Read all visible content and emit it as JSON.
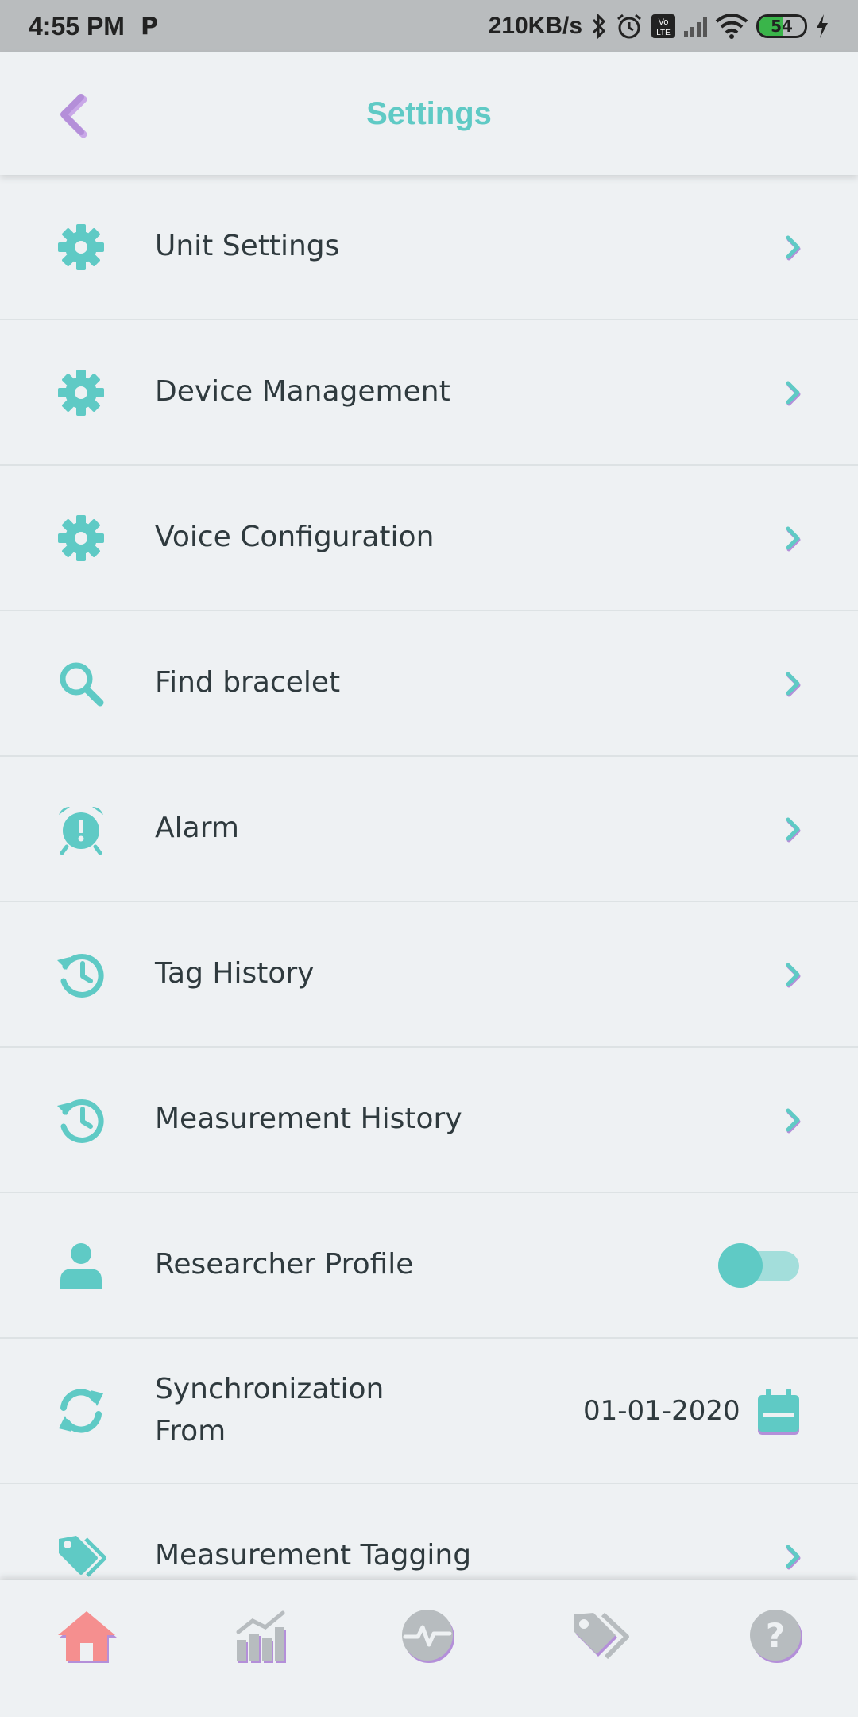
{
  "status_bar": {
    "time": "4:55 PM",
    "p_glyph": "P",
    "net_speed": "210KB/s",
    "battery": "54",
    "icons": [
      "bluetooth-icon",
      "alarm-icon",
      "volte-icon",
      "signal-icon",
      "wifi-icon",
      "battery-icon",
      "charging-icon"
    ]
  },
  "header": {
    "title": "Settings",
    "back_icon": "chevron-left-icon"
  },
  "settings": {
    "items": [
      {
        "label": "Unit Settings",
        "icon": "gear-icon",
        "action": "chevron"
      },
      {
        "label": "Device Management",
        "icon": "gear-icon",
        "action": "chevron"
      },
      {
        "label": "Voice Configuration",
        "icon": "gear-icon",
        "action": "chevron"
      },
      {
        "label": "Find bracelet",
        "icon": "search-icon",
        "action": "chevron"
      },
      {
        "label": "Alarm",
        "icon": "alarm-clock-icon",
        "action": "chevron"
      },
      {
        "label": "Tag History",
        "icon": "history-icon",
        "action": "chevron"
      },
      {
        "label": "Measurement History",
        "icon": "history-icon",
        "action": "chevron"
      },
      {
        "label": "Researcher Profile",
        "icon": "person-icon",
        "action": "toggle",
        "toggle_on": true
      },
      {
        "label": "Synchronization",
        "label_line2": "From",
        "icon": "sync-icon",
        "action": "date",
        "date": "01-01-2020"
      },
      {
        "label": "Measurement Tagging",
        "icon": "tag-icon",
        "action": "chevron"
      }
    ]
  },
  "bottom_nav": {
    "items": [
      {
        "icon": "home-icon",
        "active": true
      },
      {
        "icon": "bar-chart-icon",
        "active": false
      },
      {
        "icon": "heartbeat-icon",
        "active": false
      },
      {
        "icon": "tags-icon",
        "active": false
      },
      {
        "icon": "help-icon",
        "active": false
      }
    ]
  },
  "colors": {
    "accent": "#5fcac5",
    "purple_shadow": "#b48fd9",
    "home_active": "#f58f8f",
    "nav_inactive": "#b7bcbf",
    "background": "#eef1f3"
  }
}
